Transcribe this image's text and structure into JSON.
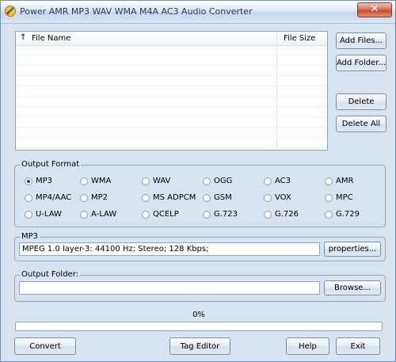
{
  "window": {
    "title": "Power AMR MP3 WAV WMA M4A AC3 Audio Converter",
    "close_glyph": "✕"
  },
  "file_list": {
    "columns": [
      "File Name",
      "File Size"
    ],
    "sort_glyph": "↑",
    "rows": []
  },
  "side_buttons": {
    "add_files": "Add Files...",
    "add_folder": "Add Folder...",
    "delete": "Delete",
    "delete_all": "Delete All"
  },
  "output_format": {
    "label": "Output Format",
    "selected": "MP3",
    "options": [
      [
        "MP3",
        "WMA",
        "WAV",
        "OGG",
        "AC3",
        "AMR"
      ],
      [
        "MP4/AAC",
        "MP2",
        "MS ADPCM",
        "GSM",
        "VOX",
        "MPC"
      ],
      [
        "U-LAW",
        "A-LAW",
        "QCELP",
        "G.723",
        "G.726",
        "G.729"
      ]
    ]
  },
  "settings": {
    "label": "MP3",
    "value": "MPEG 1.0 layer-3: 44100 Hz; Stereo;  128 Kbps;",
    "properties_button": "properties..."
  },
  "output_folder": {
    "label": "Output Folder:",
    "value": "",
    "browse_button": "Browse..."
  },
  "progress": {
    "text": "0%",
    "fraction": 0
  },
  "bottom_buttons": {
    "convert": "Convert",
    "tag_editor": "Tag Editor",
    "help": "Help",
    "exit": "Exit"
  },
  "colors": {
    "accent": "#1e395b",
    "progress_fill": "#3ab23a"
  }
}
